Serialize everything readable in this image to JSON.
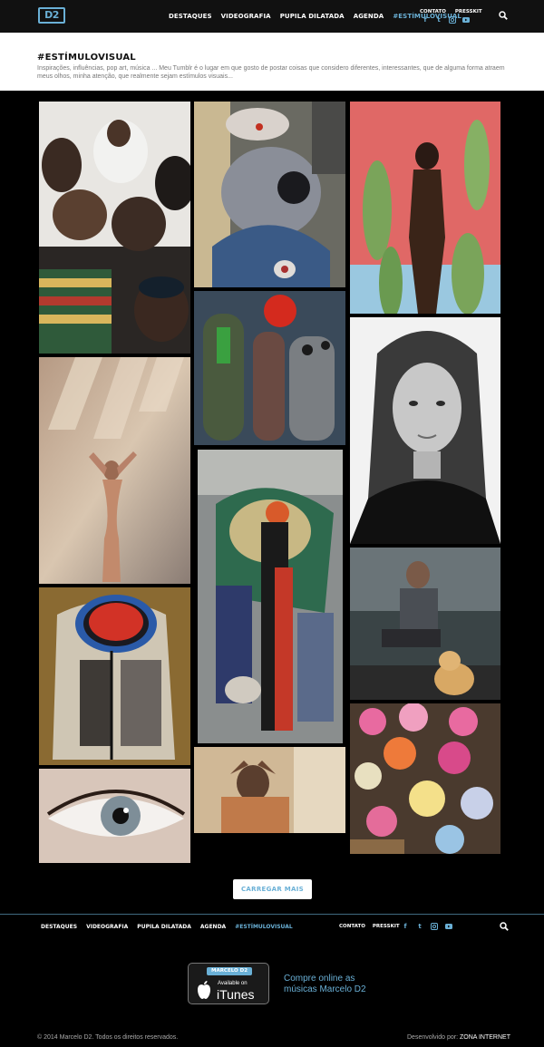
{
  "header": {
    "logo_text": "D2",
    "nav": [
      "DESTAQUES",
      "VIDEOGRAFIA",
      "PUPILA DILATADA",
      "AGENDA",
      "#ESTÍMULOVISUAL"
    ],
    "active_nav": "#ESTÍMULOVISUAL",
    "top_links": [
      "CONTATO",
      "PRESSKIT"
    ],
    "social_icons": [
      "facebook-icon",
      "twitter-icon",
      "instagram-icon",
      "youtube-icon"
    ]
  },
  "intro": {
    "title": "#ESTÍMULOVISUAL",
    "text": "Inspirações, influências, pop art, música ... Meu Tumblr é o lugar em que gosto de postar coisas que considero diferentes, interessantes, que de alguma forma atraem meus olhos, minha atenção, que realmente sejam estímulos visuais..."
  },
  "gallery": {
    "load_more_label": "CARREGAR MAIS"
  },
  "footer": {
    "nav": [
      "DESTAQUES",
      "VIDEOGRAFIA",
      "PUPILA DILATADA",
      "AGENDA",
      "#ESTÍMULOVISUAL"
    ],
    "top_links": [
      "CONTATO",
      "PRESSKIT"
    ],
    "itunes": {
      "tag": "MARCELO D2",
      "available": "Available on",
      "brand": "iTunes"
    },
    "buy_text": "Compre online as músicas Marcelo D2",
    "copyright": "© 2014 Marcelo D2. Todos os direitos reservados.",
    "credit_prefix": "Desenvolvido por: ",
    "credit_name": "ZONA INTERNET"
  },
  "colors": {
    "accent": "#6ab0d6",
    "background": "#000000"
  }
}
